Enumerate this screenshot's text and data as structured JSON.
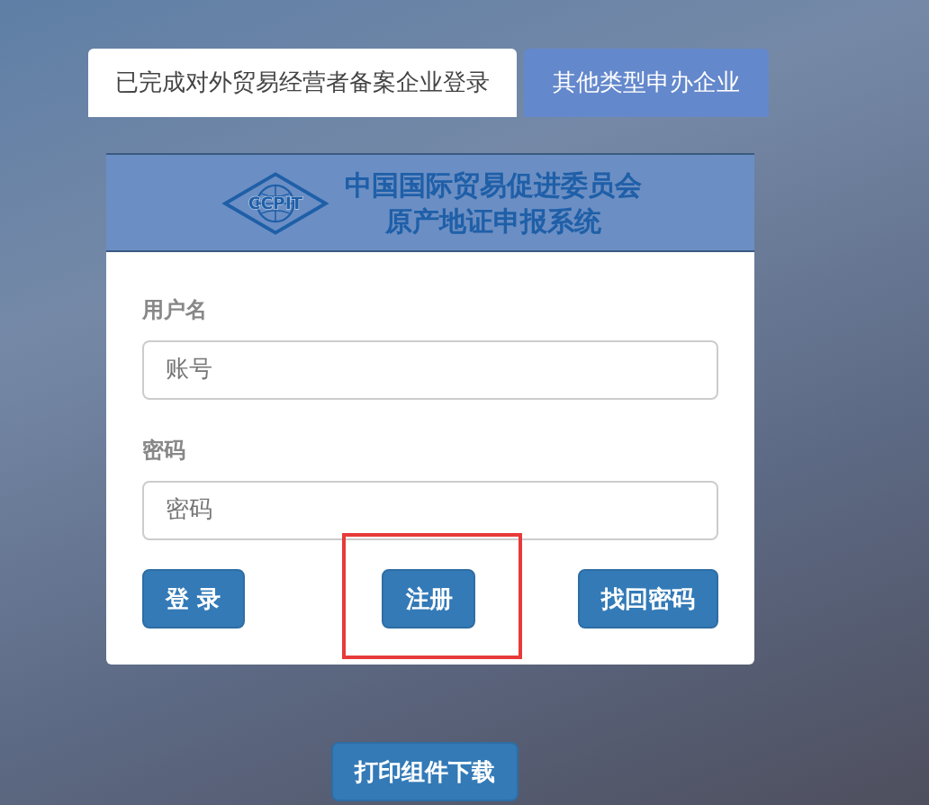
{
  "tabs": [
    {
      "label": "已完成对外贸易经营者备案企业登录",
      "selected": true
    },
    {
      "label": "其他类型申办企业",
      "selected": false
    }
  ],
  "header": {
    "logo_text": "CCPIT",
    "title_line_1": "中国国际贸易促进委员会",
    "title_line_2": "原产地证申报系统"
  },
  "fields": [
    {
      "label": "用户名",
      "placeholder": "账号"
    },
    {
      "label": "密码",
      "placeholder": "密码"
    }
  ],
  "buttons": [
    {
      "label": "登 录",
      "highlighted": false
    },
    {
      "label": "注册",
      "highlighted": true
    },
    {
      "label": "找回密码",
      "highlighted": false
    }
  ],
  "download_button": "打印组件下载"
}
